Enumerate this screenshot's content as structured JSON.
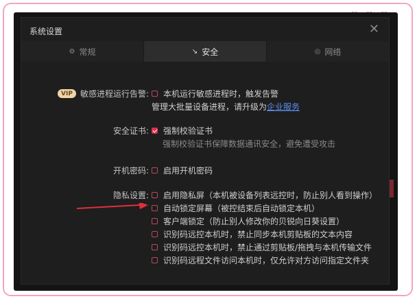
{
  "decor": {
    "hearts": [
      "♥",
      "♥",
      "♥"
    ]
  },
  "dialog": {
    "title": "系统设置",
    "close": "✕"
  },
  "tabs": [
    {
      "icon": "⚙",
      "label": "常规"
    },
    {
      "icon": "↘",
      "label": "安全"
    },
    {
      "icon": "◎",
      "label": "网络"
    }
  ],
  "security": {
    "sensitive": {
      "vip": "VIP",
      "label": "敏感进程运行告警:",
      "option": "本机运行敏感进程时，触发告警",
      "note_prefix": "管理大批量设备进程，请升级为",
      "note_link": "企业服务"
    },
    "cert": {
      "label": "安全证书:",
      "option": "强制校验证书",
      "note": "强制校验证书保障数据通讯安全，避免遭受攻击"
    },
    "boot": {
      "label": "开机密码:",
      "option": "启用开机密码"
    },
    "privacy": {
      "label": "隐私设置:",
      "options": [
        "启用隐私屏（本机被设备列表远控时，防止别人看到操作）",
        "自动锁定屏幕（被控结束后自动锁定本机）",
        "客户端锁定（防止别人修改你的贝锐向日葵设置）",
        "识别码远控本机时，禁止同步本机剪贴板的文本内容",
        "识别码远控本机时，禁止通过剪贴板/拖拽与本机传输文件",
        "识别码远程文件访问本机时，仅允许对方访问指定文件夹"
      ]
    }
  },
  "colors": {
    "accent": "#d8324e",
    "link": "#5b8ef0",
    "annotation_arrow": "#e0303a"
  }
}
